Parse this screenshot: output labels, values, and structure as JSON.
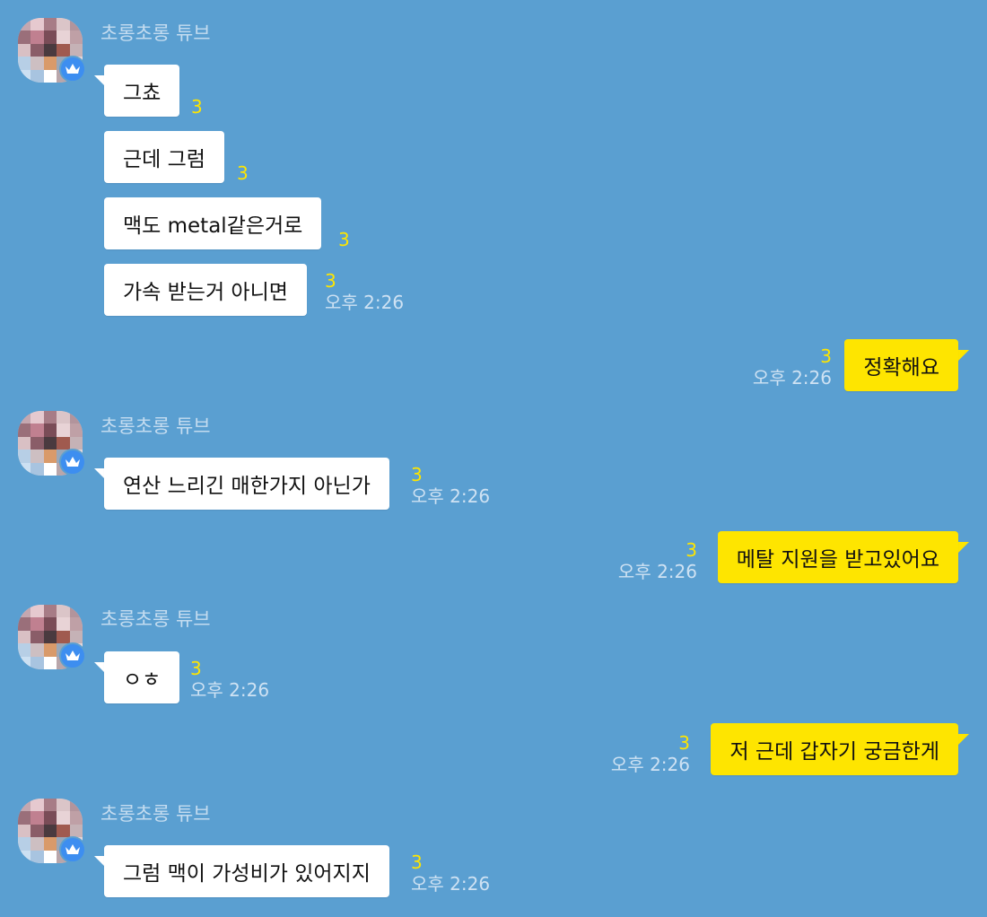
{
  "chat": {
    "sender_name": "초롱초롱 튜브",
    "colors": {
      "background": "#5a9fd1",
      "incoming_bubble": "#ffffff",
      "outgoing_bubble": "#fee500",
      "unread": "#fee500",
      "badge": "#3d8ef0"
    },
    "avatar_icon": "pixelated-avatar",
    "badge_icon": "crown-icon",
    "groups": [
      {
        "direction": "in",
        "messages": [
          {
            "text": "그쵸",
            "unread": "3",
            "time": ""
          },
          {
            "text": "근데 그럼",
            "unread": "3",
            "time": ""
          },
          {
            "text": "맥도 metal같은거로",
            "unread": "3",
            "time": ""
          },
          {
            "text": "가속 받는거 아니면",
            "unread": "3",
            "time": "오후 2:26"
          }
        ]
      },
      {
        "direction": "out",
        "messages": [
          {
            "text": "정확해요",
            "unread": "3",
            "time": "오후 2:26"
          }
        ]
      },
      {
        "direction": "in",
        "messages": [
          {
            "text": "연산 느리긴 매한가지 아닌가",
            "unread": "3",
            "time": "오후 2:26"
          }
        ]
      },
      {
        "direction": "out",
        "messages": [
          {
            "text": "메탈 지원을 받고있어요",
            "unread": "3",
            "time": "오후 2:26"
          }
        ]
      },
      {
        "direction": "in",
        "messages": [
          {
            "text": "ㅇㅎ",
            "unread": "3",
            "time": "오후 2:26"
          }
        ]
      },
      {
        "direction": "out",
        "messages": [
          {
            "text": "저 근데 갑자기 궁금한게",
            "unread": "3",
            "time": "오후 2:26"
          }
        ]
      },
      {
        "direction": "in",
        "messages": [
          {
            "text": "그럼 맥이 가성비가 있어지지",
            "unread": "3",
            "time": "오후 2:26"
          }
        ]
      }
    ]
  }
}
